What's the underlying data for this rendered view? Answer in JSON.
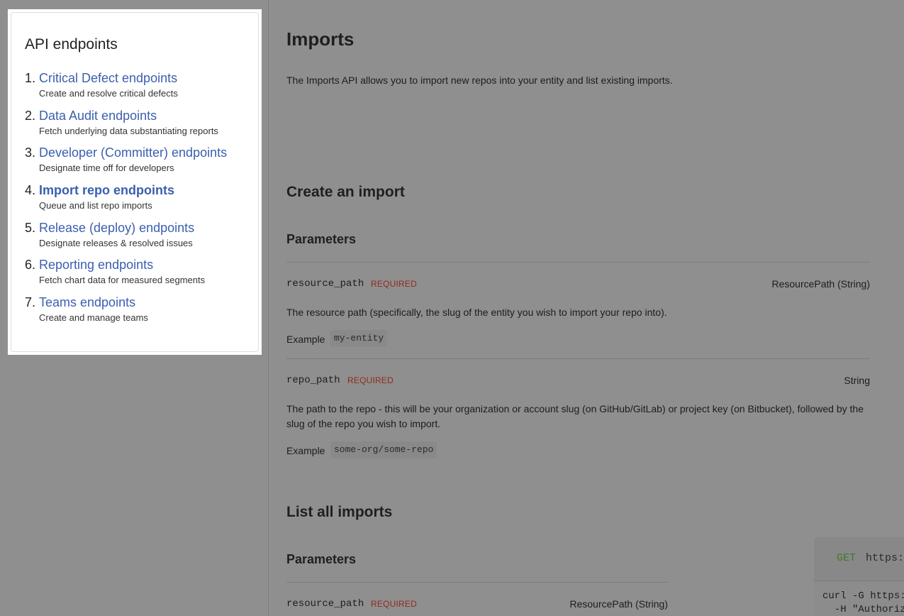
{
  "sidebar": {
    "title": "API endpoints",
    "items": [
      {
        "num": "1.",
        "label": "Critical Defect endpoints",
        "desc": "Create and resolve critical defects"
      },
      {
        "num": "2.",
        "label": "Data Audit endpoints",
        "desc": "Fetch underlying data substantiating reports"
      },
      {
        "num": "3.",
        "label": "Developer (Committer) endpoints",
        "desc": "Designate time off for developers"
      },
      {
        "num": "4.",
        "label": "Import repo endpoints",
        "desc": "Queue and list repo imports"
      },
      {
        "num": "5.",
        "label": "Release (deploy) endpoints",
        "desc": "Designate releases & resolved issues"
      },
      {
        "num": "6.",
        "label": "Reporting endpoints",
        "desc": "Fetch chart data for measured segments"
      },
      {
        "num": "7.",
        "label": "Teams endpoints",
        "desc": "Create and manage teams"
      }
    ]
  },
  "main": {
    "title": "Imports",
    "intro": "The Imports API allows you to import new repos into your entity and list existing imports.",
    "create": {
      "heading": "Create an import",
      "params_heading": "Parameters",
      "params": [
        {
          "name": "resource_path",
          "required": "REQUIRED",
          "type": "ResourcePath (String)",
          "desc": "The resource path (specifically, the slug of the entity you wish to import your repo into).",
          "example_label": "Example",
          "example": "my-entity"
        },
        {
          "name": "repo_path",
          "required": "REQUIRED",
          "type": "String",
          "desc": "The path to the repo - this will be your organization or account slug (on GitHub/GitLab) or project key (on Bitbucket), followed by the slug of the repo you wish to import.",
          "example_label": "Example",
          "example": "some-org/some-repo"
        }
      ]
    },
    "list": {
      "heading": "List all imports",
      "params_heading": "Parameters",
      "params": [
        {
          "name": "resource_path",
          "required": "REQUIRED",
          "type": "ResourcePath (String)"
        }
      ]
    }
  },
  "code_panel": {
    "method": "GET",
    "url": "https:",
    "line1": "curl -G https:",
    "line2": "  -H \"Authoriz"
  }
}
